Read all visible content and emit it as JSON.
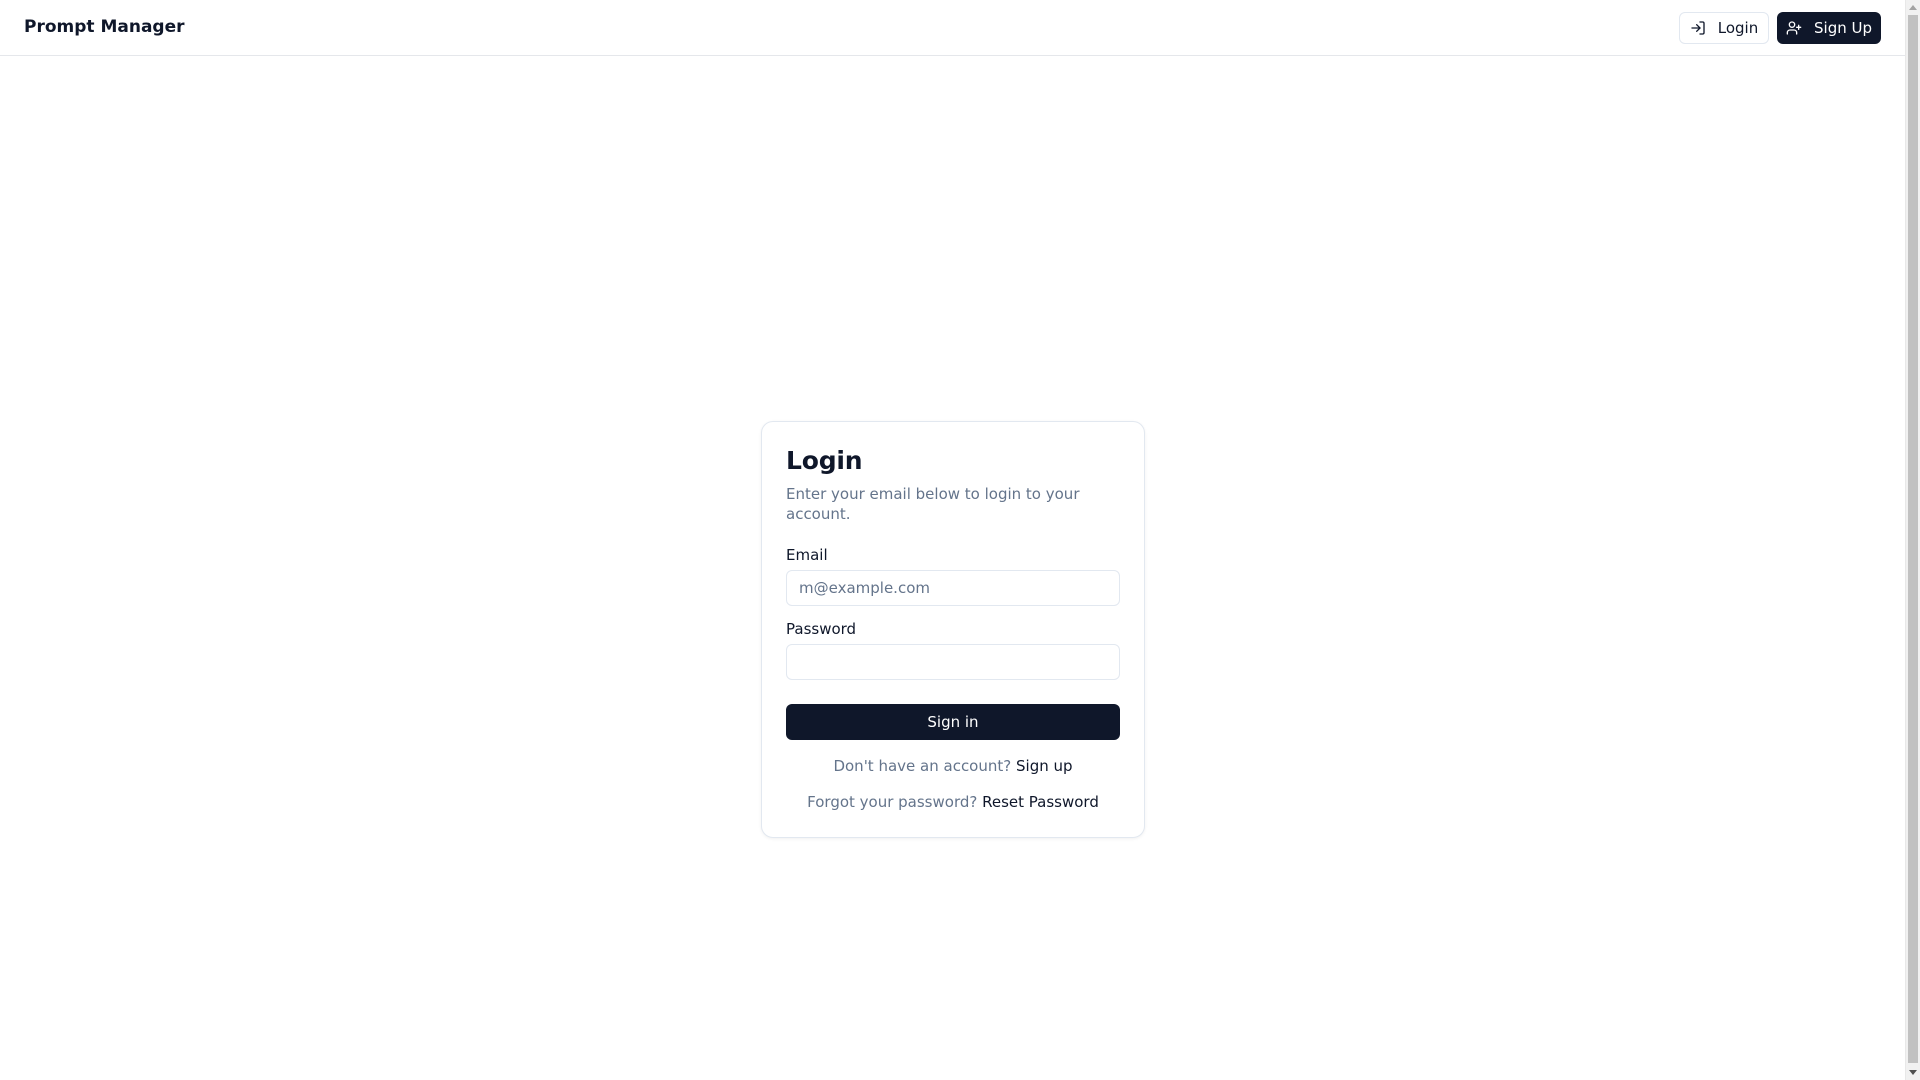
{
  "header": {
    "brand": "Prompt Manager",
    "login_label": "Login",
    "signup_label": "Sign Up"
  },
  "login_card": {
    "title": "Login",
    "description": "Enter your email below to login to your account.",
    "email_label": "Email",
    "email_placeholder": "m@example.com",
    "email_value": "",
    "password_label": "Password",
    "password_value": "",
    "submit_label": "Sign in",
    "no_account_text": "Don't have an account?",
    "signup_link": "Sign up",
    "forgot_text": "Forgot your password?",
    "reset_link": "Reset Password"
  },
  "icons": {
    "login": "log-in-icon",
    "signup": "user-plus-icon"
  },
  "colors": {
    "primary": "#0f172a",
    "muted_text": "#64748b",
    "border": "#e2e8f0"
  }
}
